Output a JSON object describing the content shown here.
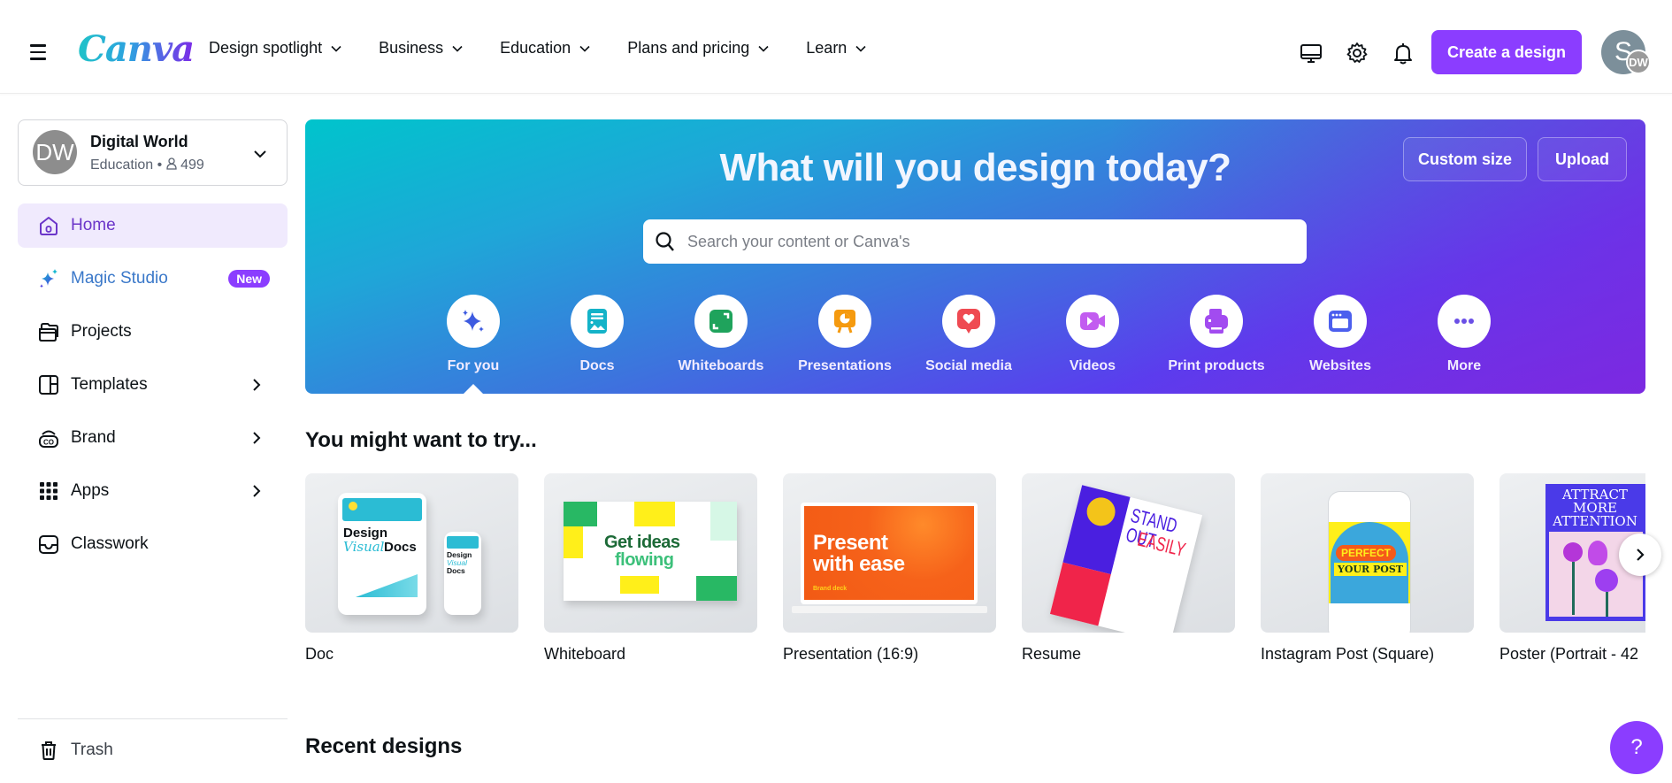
{
  "header": {
    "logo": "Canva",
    "nav": [
      {
        "label": "Design spotlight"
      },
      {
        "label": "Business"
      },
      {
        "label": "Education"
      },
      {
        "label": "Plans and pricing"
      },
      {
        "label": "Learn"
      }
    ],
    "icons": [
      "desktop-app-icon",
      "settings-gear-icon",
      "notification-bell-icon"
    ],
    "create_label": "Create a design",
    "avatar_initial": "S",
    "avatar_sub": "DW",
    "accent": "#8b3dff"
  },
  "sidebar": {
    "team": {
      "avatar": "DW",
      "name": "Digital World",
      "plan": "Education",
      "members": "499"
    },
    "items": [
      {
        "label": "Home",
        "icon": "home-icon",
        "active": true
      },
      {
        "label": "Magic Studio",
        "icon": "sparkle-icon",
        "badge": "New"
      },
      {
        "label": "Projects",
        "icon": "folder-icon"
      },
      {
        "label": "Templates",
        "icon": "templates-icon",
        "chevron": true
      },
      {
        "label": "Brand",
        "icon": "brand-icon",
        "chevron": true
      },
      {
        "label": "Apps",
        "icon": "apps-grid-icon",
        "chevron": true
      },
      {
        "label": "Classwork",
        "icon": "inbox-tray-icon"
      }
    ],
    "trash": {
      "label": "Trash",
      "icon": "trash-icon"
    }
  },
  "hero": {
    "title": "What will you design today?",
    "custom_size": "Custom size",
    "upload": "Upload",
    "search_placeholder": "Search your content or Canva's",
    "categories": [
      {
        "label": "For you",
        "icon": "sparkles-icon",
        "color": "#3d5be0",
        "selected": true
      },
      {
        "label": "Docs",
        "icon": "doc-icon",
        "color": "#14b3c8"
      },
      {
        "label": "Whiteboards",
        "icon": "whiteboard-icon",
        "color": "#1fa35c"
      },
      {
        "label": "Presentations",
        "icon": "presentation-icon",
        "color": "#f59a0f"
      },
      {
        "label": "Social media",
        "icon": "social-heart-icon",
        "color": "#ef4a52"
      },
      {
        "label": "Videos",
        "icon": "video-icon",
        "color": "#c25cf0"
      },
      {
        "label": "Print products",
        "icon": "printer-icon",
        "color": "#a24bf0"
      },
      {
        "label": "Websites",
        "icon": "website-icon",
        "color": "#4c5fee"
      },
      {
        "label": "More",
        "icon": "more-dots-icon",
        "color": "#6a4fe6"
      }
    ]
  },
  "suggestions": {
    "title": "You might want to try...",
    "cards": [
      {
        "label": "Doc",
        "thumb_text": [
          "Design",
          "Visual",
          "Docs"
        ]
      },
      {
        "label": "Whiteboard",
        "thumb_text": [
          "Get ideas",
          "flowing"
        ]
      },
      {
        "label": "Presentation (16:9)",
        "thumb_text": [
          "Present",
          "with ease",
          "Brand deck"
        ]
      },
      {
        "label": "Resume",
        "thumb_text": [
          "STAND OUT",
          "EASILY"
        ]
      },
      {
        "label": "Instagram Post (Square)",
        "thumb_text": [
          "PERFECT",
          "YOUR POST"
        ]
      },
      {
        "label": "Poster (Portrait - 42",
        "thumb_text": [
          "ATTRACT",
          "MORE",
          "ATTENTION"
        ]
      }
    ]
  },
  "recent": {
    "title": "Recent designs"
  },
  "help_label": "?"
}
